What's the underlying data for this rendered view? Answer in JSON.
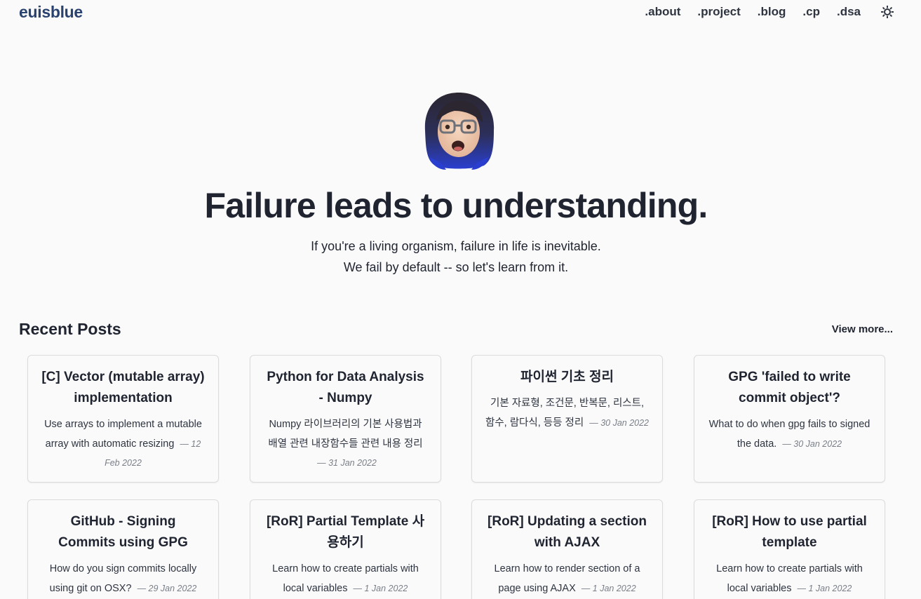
{
  "header": {
    "brand": "euisblue",
    "nav": [
      ".about",
      ".project",
      ".blog",
      ".cp",
      ".dsa"
    ]
  },
  "hero": {
    "headline": "Failure leads to understanding.",
    "line1": "If you're a living organism, failure in life is inevitable.",
    "line2": "We fail by default -- so let's learn from it."
  },
  "recent": {
    "title": "Recent Posts",
    "view_more": "View more...",
    "posts": [
      {
        "title": "[C] Vector (mutable array) implementation",
        "desc": "Use arrays to implement a mutable array with automatic resizing",
        "date": "— 12 Feb 2022"
      },
      {
        "title": "Python for Data Analysis - Numpy",
        "desc": "Numpy 라이브러리의 기본 사용법과 배열 관련 내장함수들 관련 내용 정리",
        "date": "— 31 Jan 2022"
      },
      {
        "title": "파이썬 기초 정리",
        "desc": "기본 자료형, 조건문, 반복문, 리스트, 함수, 람다식, 등등 정리",
        "date": "— 30 Jan 2022"
      },
      {
        "title": "GPG 'failed to write commit object'?",
        "desc": "What to do when gpg fails to signed the data.",
        "date": "— 30 Jan 2022"
      },
      {
        "title": "GitHub - Signing Commits using GPG",
        "desc": "How do you sign commits locally using git on OSX?",
        "date": "— 29 Jan 2022"
      },
      {
        "title": "[RoR] Partial Template 사용하기",
        "desc": "Learn how to create partials with local variables",
        "date": "— 1 Jan 2022"
      },
      {
        "title": "[RoR] Updating a section with AJAX",
        "desc": "Learn how to render section of a page using AJAX",
        "date": "— 1 Jan 2022"
      },
      {
        "title": "[RoR] How to use partial template",
        "desc": "Learn how to create partials with local variables",
        "date": "— 1 Jan 2022"
      }
    ]
  },
  "icons": {
    "theme_toggle": "sun-icon",
    "avatar": "memoji-avatar"
  },
  "colors": {
    "brand": "#2a4270",
    "text": "#1f2430",
    "background": "#fafafa",
    "card_border": "#dcdcdc",
    "date": "#7a7f88"
  }
}
